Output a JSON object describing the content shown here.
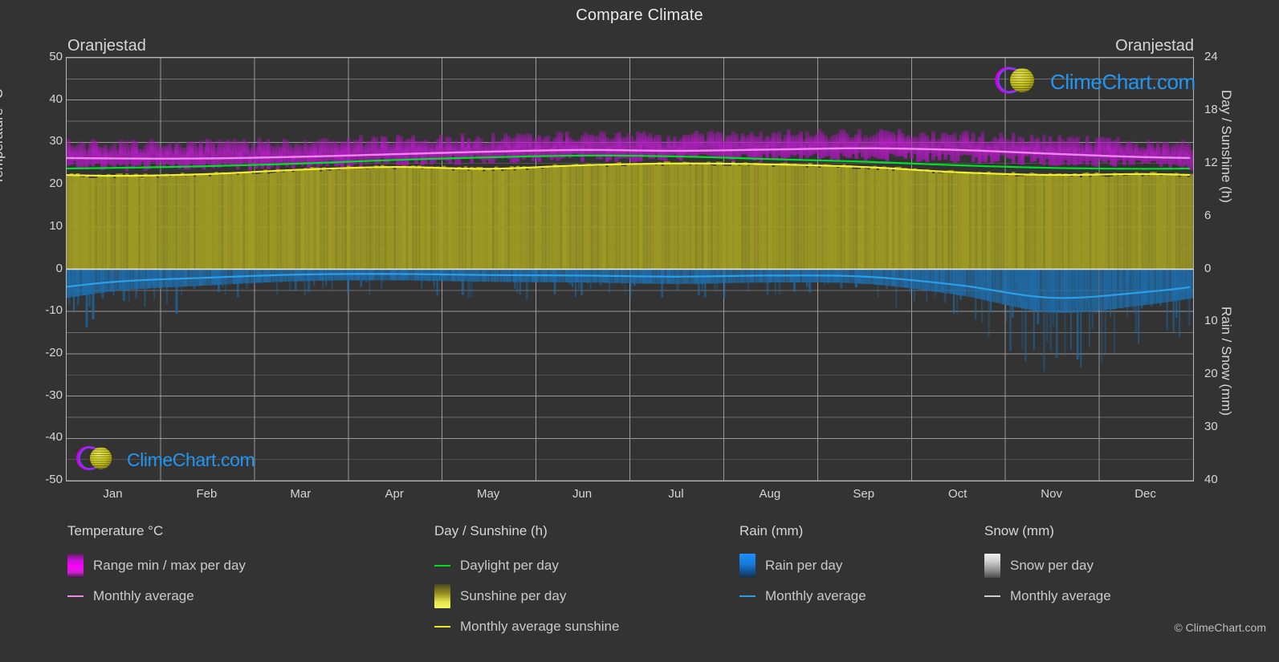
{
  "header": {
    "title": "Compare Climate",
    "city_left": "Oranjestad",
    "city_right": "Oranjestad"
  },
  "axes": {
    "left_label": "Temperature °C",
    "right_label_top": "Day / Sunshine (h)",
    "right_label_bottom": "Rain / Snow (mm)",
    "left_ticks": [
      "50",
      "40",
      "30",
      "20",
      "10",
      "0",
      "-10",
      "-20",
      "-30",
      "-40",
      "-50"
    ],
    "right_ticks_top": [
      "24",
      "18",
      "12",
      "6",
      "0"
    ],
    "right_ticks_bottom": [
      "10",
      "20",
      "30",
      "40"
    ],
    "x_ticks": [
      "Jan",
      "Feb",
      "Mar",
      "Apr",
      "May",
      "Jun",
      "Jul",
      "Aug",
      "Sep",
      "Oct",
      "Nov",
      "Dec"
    ]
  },
  "legend": {
    "columns": [
      {
        "title": "Temperature °C",
        "items": [
          {
            "label": "Range min / max per day",
            "mark": "swatch",
            "style": "sw-temp"
          },
          {
            "label": "Monthly average",
            "mark": "line",
            "style": "ln-temp"
          }
        ]
      },
      {
        "title": "Day / Sunshine (h)",
        "items": [
          {
            "label": "Daylight per day",
            "mark": "line",
            "style": "ln-day"
          },
          {
            "label": "Sunshine per day",
            "mark": "swatch",
            "style": "sw-sun"
          },
          {
            "label": "Monthly average sunshine",
            "mark": "line",
            "style": "ln-sun"
          }
        ]
      },
      {
        "title": "Rain (mm)",
        "items": [
          {
            "label": "Rain per day",
            "mark": "swatch",
            "style": "sw-rain"
          },
          {
            "label": "Monthly average",
            "mark": "line",
            "style": "ln-rain"
          }
        ]
      },
      {
        "title": "Snow (mm)",
        "items": [
          {
            "label": "Snow per day",
            "mark": "swatch",
            "style": "sw-snow"
          },
          {
            "label": "Monthly average",
            "mark": "line",
            "style": "ln-snow"
          }
        ]
      }
    ]
  },
  "branding": {
    "wordmark": "ClimeChart.com",
    "copyright": "© ClimeChart.com"
  },
  "colors": {
    "background": "#333333",
    "grid": "#8f8f8f",
    "frame": "#b9b9b9",
    "temp_band": "#b11ec0",
    "temp_avg_line": "#f06ef0",
    "daylight_line": "#00e024",
    "sunshine_fill": "#9e9a24",
    "sunshine_line": "#f0f030",
    "rain_fill": "#1f6fae",
    "rain_avg_line": "#2e9ee6",
    "logo_blue": "#2196f3",
    "logo_magenta": "#e000e0",
    "logo_yellow": "#d6d41e"
  },
  "chart_data": {
    "type": "area",
    "title": "Compare Climate",
    "subtitle": "Oranjestad",
    "xlabel": "",
    "ylabel": "Temperature °C",
    "y2label_top": "Day / Sunshine (h)",
    "y2label_bottom": "Rain / Snow (mm)",
    "grid": true,
    "legend_position": "bottom",
    "ylim": [
      -50,
      50
    ],
    "y2lim_sunshine": [
      0,
      24
    ],
    "y2lim_rain": [
      0,
      40
    ],
    "categories": [
      "Jan",
      "Feb",
      "Mar",
      "Apr",
      "May",
      "Jun",
      "Jul",
      "Aug",
      "Sep",
      "Oct",
      "Nov",
      "Dec"
    ],
    "series": [
      {
        "name": "Temperature monthly average",
        "unit": "°C",
        "color": "#f06ef0",
        "values": [
          26.2,
          26.2,
          26.6,
          27.2,
          27.8,
          28.2,
          28.0,
          28.3,
          28.6,
          28.2,
          27.3,
          26.5
        ]
      },
      {
        "name": "Temperature range max per day",
        "unit": "°C",
        "color": "#b11ec0",
        "values": [
          29.4,
          29.5,
          30.0,
          30.6,
          31.0,
          31.4,
          31.3,
          31.6,
          31.9,
          31.4,
          30.6,
          29.7
        ]
      },
      {
        "name": "Temperature range min per day",
        "unit": "°C",
        "color": "#b11ec0",
        "values": [
          24.4,
          24.4,
          24.7,
          25.4,
          26.1,
          26.4,
          26.2,
          26.4,
          26.6,
          26.3,
          25.6,
          24.8
        ]
      },
      {
        "name": "Daylight per day",
        "unit": "h",
        "color": "#00e024",
        "values": [
          11.5,
          11.7,
          12.0,
          12.4,
          12.7,
          12.9,
          12.8,
          12.5,
          12.2,
          11.8,
          11.5,
          11.4
        ]
      },
      {
        "name": "Monthly average sunshine",
        "unit": "h",
        "color": "#f0f030",
        "values": [
          10.6,
          10.8,
          11.3,
          11.6,
          11.4,
          11.8,
          12.0,
          11.9,
          11.6,
          11.0,
          10.7,
          10.8
        ]
      },
      {
        "name": "Rain monthly average",
        "unit": "mm",
        "color": "#2e9ee6",
        "values": [
          2.4,
          1.6,
          1.0,
          0.9,
          1.1,
          1.2,
          1.4,
          1.2,
          1.4,
          3.0,
          5.4,
          4.3
        ]
      },
      {
        "name": "Snow monthly average",
        "unit": "mm",
        "color": "#cfcfcf",
        "values": [
          0,
          0,
          0,
          0,
          0,
          0,
          0,
          0,
          0,
          0,
          0,
          0
        ]
      }
    ]
  }
}
